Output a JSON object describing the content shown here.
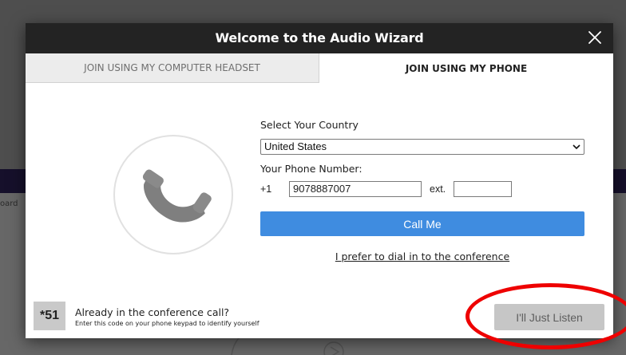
{
  "background": {
    "side_tab_fragment": "oard"
  },
  "modal": {
    "title": "Welcome to the Audio Wizard",
    "close_icon": "close-icon"
  },
  "tabs": [
    {
      "label": "JOIN USING MY COMPUTER HEADSET",
      "active": false
    },
    {
      "label": "JOIN USING MY PHONE",
      "active": true
    }
  ],
  "illustration": {
    "icon": "phone-handset-icon"
  },
  "form": {
    "country_label": "Select Your Country",
    "country_value": "United States",
    "phone_label": "Your Phone Number:",
    "country_code": "+1",
    "phone_value": "9078887007",
    "ext_label": "ext.",
    "ext_value": "",
    "call_button": "Call Me",
    "dial_in_link": "I prefer to dial in to the conference"
  },
  "footer": {
    "code": "*51",
    "already_text": "Already in the conference call?",
    "hint_text": "Enter this code on your phone keypad to identify yourself",
    "listen_button": "I'll Just Listen"
  },
  "colors": {
    "header": "#232323",
    "accent": "#3f8ce0",
    "annotation": "#ee0000"
  }
}
